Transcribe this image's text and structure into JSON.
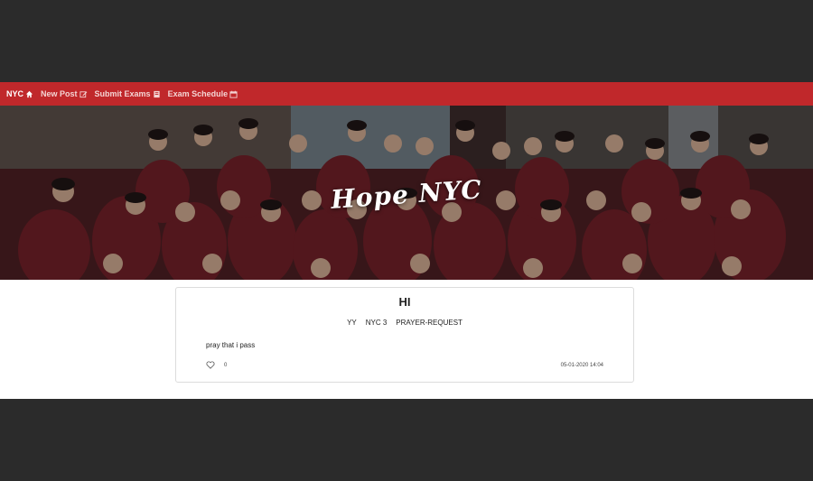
{
  "nav": {
    "brand": "NYC",
    "items": [
      {
        "label": "New Post",
        "icon": "edit-icon"
      },
      {
        "label": "Submit Exams",
        "icon": "book-icon"
      },
      {
        "label": "Exam Schedule",
        "icon": "calendar-icon"
      }
    ]
  },
  "hero": {
    "title": "Hope NYC"
  },
  "post": {
    "title": "HI",
    "tags": [
      "YY",
      "NYC 3",
      "PRAYER-REQUEST"
    ],
    "body": "pray that i pass",
    "likes": "0",
    "timestamp": "05-01-2020 14:04"
  },
  "colors": {
    "navbar": "#c0282b",
    "page_bg": "#2b2b2b"
  }
}
